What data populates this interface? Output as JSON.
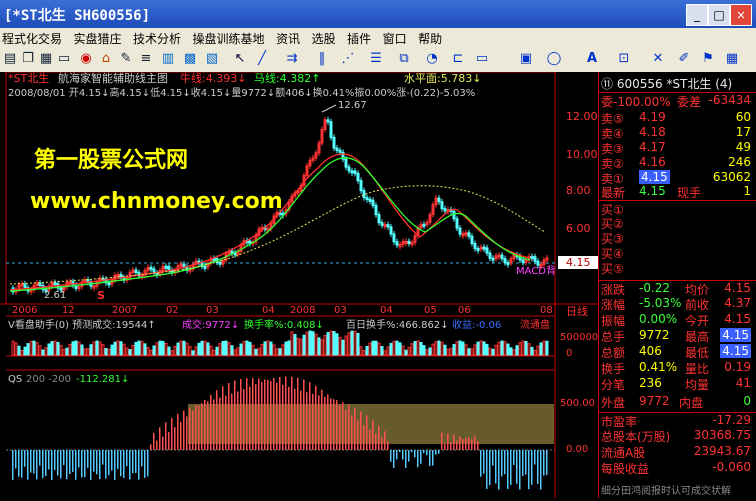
{
  "window": {
    "title": "[*ST北生 SH600556]",
    "controls": [
      "_",
      "□",
      "×"
    ]
  },
  "menu": [
    "程式化交易",
    "实盘猎庄",
    "技术分析",
    "操盘训练基地",
    "资讯",
    "选股",
    "插件",
    "窗口",
    "帮助"
  ],
  "toolbar_icons": [
    "folder-icon",
    "copy-icon",
    "grid-icon",
    "page-icon",
    "badge-icon",
    "house-icon",
    "wrench-icon",
    "list-icon",
    "table-icon",
    "chart-icon",
    "columns-icon",
    "cursor-icon",
    "line-icon",
    "trend-icon",
    "bars-icon",
    "fan-icon",
    "fib-icon",
    "rect-icon",
    "circle-icon",
    "text-icon",
    "label-icon",
    "brush-icon",
    "bucket-icon",
    "window-icon"
  ],
  "main_chart": {
    "header_name": "*ST北生",
    "indicator_title": "航海家智能辅助线主图",
    "niu_label": "牛线:4.393↓",
    "ma_label": "马线:4.382↑",
    "horizon_label": "水平面:5.783↓",
    "ohlc_line": "2008/08/01 开4.15↓高4.15↓低4.15↓收4.15↓量9772↓额406↓换0.41%振0.00%涨-(0.22)-5.03%",
    "high_marker": "12.67",
    "low_marker": "2.61",
    "current_price_tag": "4.15",
    "macd_label": "MACD背",
    "watermark1": "第一股票公式网",
    "watermark2": "www.chnmoney.com",
    "y_axis": [
      "12.00",
      "10.00",
      "8.00",
      "6.00",
      "4.00"
    ],
    "x_axis": [
      "2006",
      "12",
      "2007",
      "02",
      "03",
      "04",
      "2008",
      "03",
      "04",
      "05",
      "06",
      "08"
    ],
    "period": "日线"
  },
  "volume_panel": {
    "title": "V看盘助手(0) 预测成交:19544↑",
    "chengjiao": "成交:9772↓",
    "huanshoulv": "换手率%:0.408↓",
    "baiday": "百日换手%:466.862↓",
    "shouyi": "收益:-0.06",
    "liutong": "流通盘",
    "y_axis": [
      "500000",
      "0"
    ]
  },
  "qs_panel": {
    "name": "QS",
    "params": "200 -200",
    "value": "-112.281↓",
    "y_axis": [
      "500.00",
      "0.00"
    ]
  },
  "quote": {
    "code_line": "⑪ 600556 *ST北生 (4)",
    "weibi_label": "委-100.00%",
    "weicha_label": "委差",
    "weicha_value": "-63434",
    "asks": [
      {
        "label": "卖⑤",
        "price": "4.19",
        "vol": "60"
      },
      {
        "label": "卖④",
        "price": "4.18",
        "vol": "17"
      },
      {
        "label": "卖③",
        "price": "4.17",
        "vol": "49"
      },
      {
        "label": "卖②",
        "price": "4.16",
        "vol": "246"
      },
      {
        "label": "卖①",
        "price": "4.15",
        "vol": "63062"
      }
    ],
    "latest_label": "最新",
    "latest_value": "4.15",
    "xianshou_label": "现手",
    "xianshou_value": "1",
    "bids": [
      "买①",
      "买②",
      "买③",
      "买④",
      "买⑤"
    ],
    "stats": [
      {
        "l1": "涨跌",
        "v1": "-0.22",
        "l2": "均价",
        "v2": "4.15"
      },
      {
        "l1": "涨幅",
        "v1": "-5.03%",
        "l2": "前收",
        "v2": "4.37"
      },
      {
        "l1": "振幅",
        "v1": "0.00%",
        "l2": "今开",
        "v2": "4.15"
      },
      {
        "l1": "总手",
        "v1": "9772",
        "l2": "最高",
        "v2": "4.15"
      },
      {
        "l1": "总额",
        "v1": "406",
        "l2": "最低",
        "v2": "4.15"
      },
      {
        "l1": "换手",
        "v1": "0.41%",
        "l2": "量比",
        "v2": "0.19"
      },
      {
        "l1": "分笔",
        "v1": "236",
        "l2": "均量",
        "v2": "41"
      }
    ],
    "waipan_label": "外盘",
    "waipan_value": "9772",
    "neipan_label": "内盘",
    "neipan_value": "0",
    "fin": [
      {
        "l": "市盈率",
        "v": "-17.29"
      },
      {
        "l": "总股本(万股)",
        "v": "30368.75"
      },
      {
        "l": "流通A股",
        "v": "23943.67"
      },
      {
        "l": "每股收益",
        "v": "-0.060"
      }
    ],
    "footer": "细分田鸿阅报时认可成交状解"
  },
  "colors": {
    "up": "#ff3232",
    "down": "#54ffff",
    "niu_line": "#ff3030",
    "ma_line": "#30ff30",
    "horizon": "#e8e85a",
    "watermark": "#ffff00",
    "panel_border": "#c00000"
  }
}
